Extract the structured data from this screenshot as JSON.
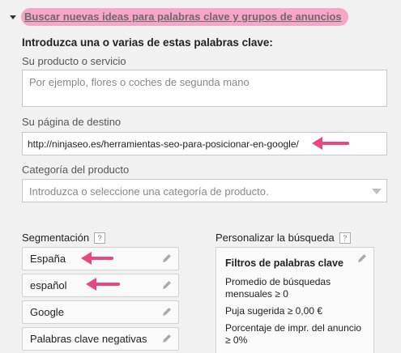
{
  "section": {
    "title": "Buscar nuevas ideas para palabras clave y grupos de anuncios"
  },
  "form": {
    "heading": "Introduzca una o varias de estas palabras clave:",
    "product_label": "Su producto o servicio",
    "product_placeholder": "Por ejemplo, flores o coches de segunda mano",
    "landing_label": "Su página de destino",
    "landing_value": "http://ninjaseo.es/herramientas-seo-para-posicionar-en-google/",
    "category_label": "Categoría del producto",
    "category_placeholder": "Introduzca o seleccione una categoría de producto."
  },
  "targeting": {
    "label": "Segmentación",
    "help": "?",
    "items": [
      {
        "label": "España"
      },
      {
        "label": "español"
      },
      {
        "label": "Google"
      },
      {
        "label": "Palabras clave negativas"
      }
    ]
  },
  "customize": {
    "label": "Personalizar la búsqueda",
    "help": "?",
    "filters_title": "Filtros de palabras clave",
    "filters": [
      "Promedio de búsquedas mensuales ≥ 0",
      "Puja sugerida ≥ 0,00 €",
      "Porcentaje de impr. del anuncio ≥ 0%"
    ]
  },
  "colors": {
    "highlight": "#f6a6c6",
    "annotation_arrow": "#e8487f",
    "background": "#f1f1f1"
  },
  "icons": {
    "caret": "caret-down-icon",
    "edit": "pencil-icon",
    "dropdown": "dropdown-arrow-icon"
  }
}
